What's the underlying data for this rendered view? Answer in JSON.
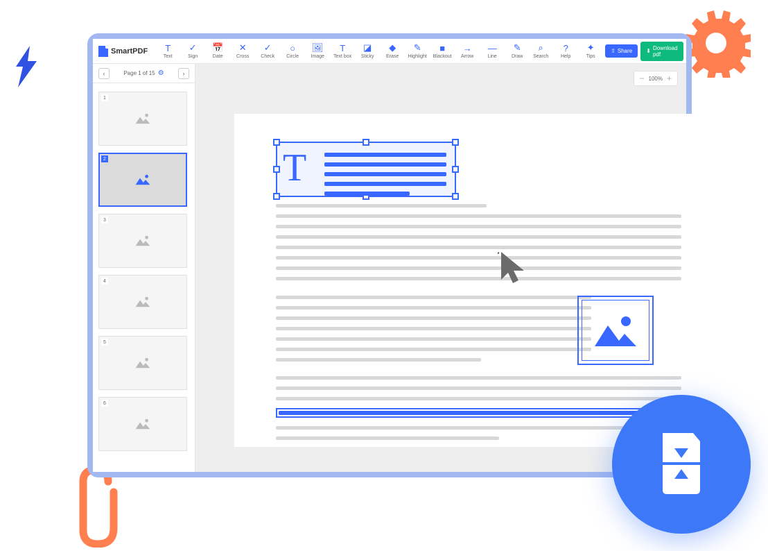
{
  "app_name": "SmartPDF",
  "toolbar": {
    "tools": [
      {
        "label": "Text",
        "icon": "T"
      },
      {
        "label": "Sign",
        "icon": "✓"
      },
      {
        "label": "Date",
        "icon": "📅"
      },
      {
        "label": "Cross",
        "icon": "✕"
      },
      {
        "label": "Check",
        "icon": "✓"
      },
      {
        "label": "Circle",
        "icon": "○"
      },
      {
        "label": "Image",
        "icon": "🖼"
      },
      {
        "label": "Text box",
        "icon": "T"
      },
      {
        "label": "Sticky",
        "icon": "◪"
      },
      {
        "label": "Erase",
        "icon": "◆"
      },
      {
        "label": "Highlight",
        "icon": "✎"
      },
      {
        "label": "Blackout",
        "icon": "■"
      },
      {
        "label": "Arrow",
        "icon": "→"
      },
      {
        "label": "Line",
        "icon": "—"
      },
      {
        "label": "Draw",
        "icon": "✎"
      }
    ],
    "right": [
      {
        "label": "Search",
        "icon": "⌕"
      },
      {
        "label": "Help",
        "icon": "?"
      },
      {
        "label": "Tips",
        "icon": "✦"
      }
    ],
    "share": "Share",
    "download": "Download pdf"
  },
  "nav": {
    "page_info": "Page 1 of 15"
  },
  "zoom": {
    "value": "100%"
  },
  "thumbs": [
    {
      "num": "1",
      "active": false
    },
    {
      "num": "2",
      "active": true
    },
    {
      "num": "3",
      "active": false
    },
    {
      "num": "4",
      "active": false
    },
    {
      "num": "5",
      "active": false
    },
    {
      "num": "6",
      "active": false
    }
  ]
}
